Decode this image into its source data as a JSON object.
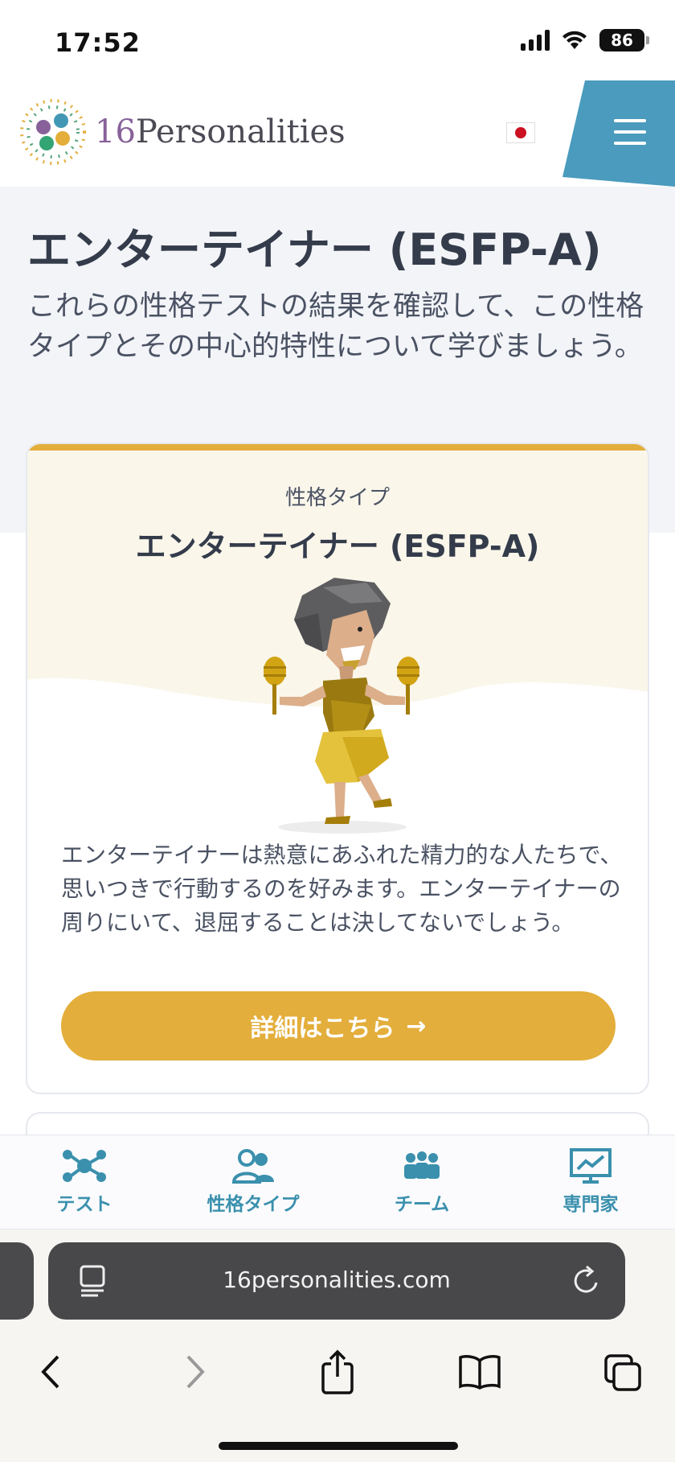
{
  "status": {
    "time": "17:52",
    "battery": "86"
  },
  "header": {
    "logo_prefix": "16",
    "logo_text": "Personalities",
    "language": "Japanese"
  },
  "page": {
    "title": "エンターテイナー (ESFP-A)",
    "subtitle": "これらの性格テストの結果を確認して、この性格タイプとその中心的特性について学びましょう。"
  },
  "card": {
    "label": "性格タイプ",
    "title": "エンターテイナー (ESFP-A)",
    "description": "エンターテイナーは熱意にあふれた精力的な人たちで、思いつきで行動するのを好みます。エンターテイナーの周りにいて、退屈することは決してないでしょう。",
    "cta_label": "詳細はこちら",
    "cta_arrow": "→"
  },
  "app_nav": {
    "items": [
      {
        "label": "テスト",
        "icon": "network-icon"
      },
      {
        "label": "性格タイプ",
        "icon": "people-icon"
      },
      {
        "label": "チーム",
        "icon": "team-icon"
      },
      {
        "label": "専門家",
        "icon": "presentation-icon"
      }
    ]
  },
  "browser": {
    "url": "16personalities.com"
  },
  "colors": {
    "accent": "#e3ae3b",
    "brand_blue": "#4a9bbd",
    "nav_text": "#3a90ad",
    "title": "#343c4b"
  }
}
